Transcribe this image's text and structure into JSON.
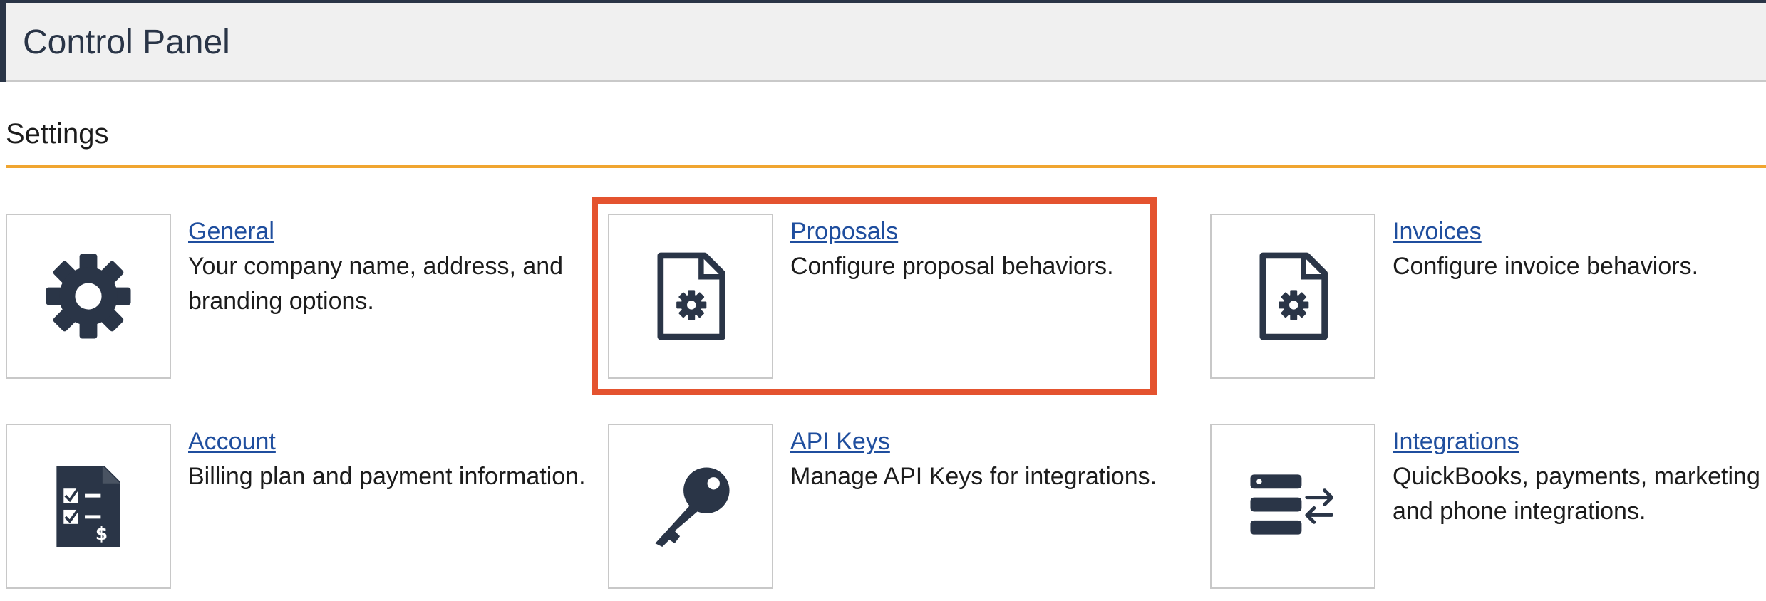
{
  "header": {
    "title": "Control Panel"
  },
  "settings": {
    "section_title": "Settings",
    "highlight_color": "#e4532f",
    "accent_color": "#f0a530",
    "tiles": [
      {
        "icon": "gear-icon",
        "label": "General",
        "description": "Your company name, address, and branding options."
      },
      {
        "icon": "document-settings-icon",
        "label": "Proposals",
        "description": "Configure proposal behaviors."
      },
      {
        "icon": "document-settings-icon",
        "label": "Invoices",
        "description": "Configure invoice behaviors."
      },
      {
        "icon": "checklist-billing-icon",
        "label": "Account",
        "description": "Billing plan and payment information."
      },
      {
        "icon": "key-icon",
        "label": "API Keys",
        "description": "Manage API Keys for integrations."
      },
      {
        "icon": "server-sync-icon",
        "label": "Integrations",
        "description": "QuickBooks, payments, marketing and phone integrations."
      }
    ]
  }
}
